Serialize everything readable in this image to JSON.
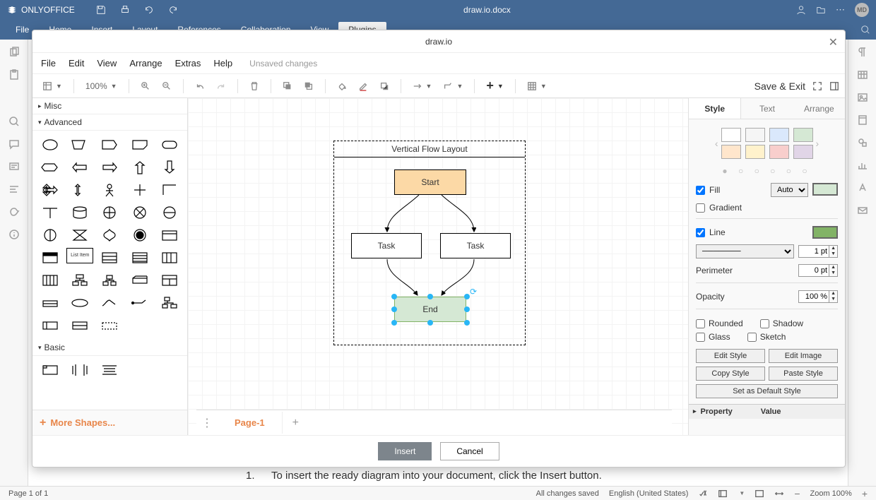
{
  "app": {
    "brand": "ONLYOFFICE",
    "document": "draw.io.docx",
    "avatar": "MD"
  },
  "oo_menu": {
    "items": [
      "File",
      "Home",
      "Insert",
      "Layout",
      "References",
      "Collaboration",
      "View",
      "Plugins"
    ],
    "active_index": 7
  },
  "status": {
    "page": "Page 1 of 1",
    "save": "All changes saved",
    "lang": "English (United States)",
    "zoom": "Zoom 100%"
  },
  "doc_behind": {
    "num": "1.",
    "text": "To insert the ready diagram into your document, click the Insert button."
  },
  "dialog": {
    "title": "draw.io",
    "insert": "Insert",
    "cancel": "Cancel"
  },
  "dio": {
    "menu": [
      "File",
      "Edit",
      "View",
      "Arrange",
      "Extras",
      "Help"
    ],
    "unsaved": "Unsaved changes",
    "zoom": "100%",
    "save_exit": "Save & Exit"
  },
  "shapes": {
    "misc": "Misc",
    "advanced": "Advanced",
    "basic": "Basic",
    "more": "More Shapes...",
    "list_item": "List Item"
  },
  "pages": {
    "page": "Page-1"
  },
  "diagram": {
    "title": "Vertical Flow Layout",
    "start": "Start",
    "task1": "Task",
    "task2": "Task",
    "end": "End"
  },
  "format": {
    "tabs": {
      "style": "Style",
      "text": "Text",
      "arrange": "Arrange"
    },
    "fill": "Fill",
    "fill_mode": "Auto",
    "gradient": "Gradient",
    "line": "Line",
    "line_width": "1 pt",
    "perimeter": "Perimeter",
    "perimeter_val": "0 pt",
    "opacity": "Opacity",
    "opacity_val": "100 %",
    "rounded": "Rounded",
    "shadow": "Shadow",
    "glass": "Glass",
    "sketch": "Sketch",
    "edit_style": "Edit Style",
    "edit_image": "Edit Image",
    "copy_style": "Copy Style",
    "paste_style": "Paste Style",
    "set_default": "Set as Default Style",
    "property": "Property",
    "value": "Value",
    "palette": [
      "#ffffff",
      "#f5f5f5",
      "#dae8fc",
      "#d5e8d4",
      "#ffe6cc",
      "#fff2cc",
      "#f8cecc",
      "#e1d5e7"
    ],
    "fill_swatch": "#d5e8d4",
    "line_swatch": "#82b366"
  }
}
